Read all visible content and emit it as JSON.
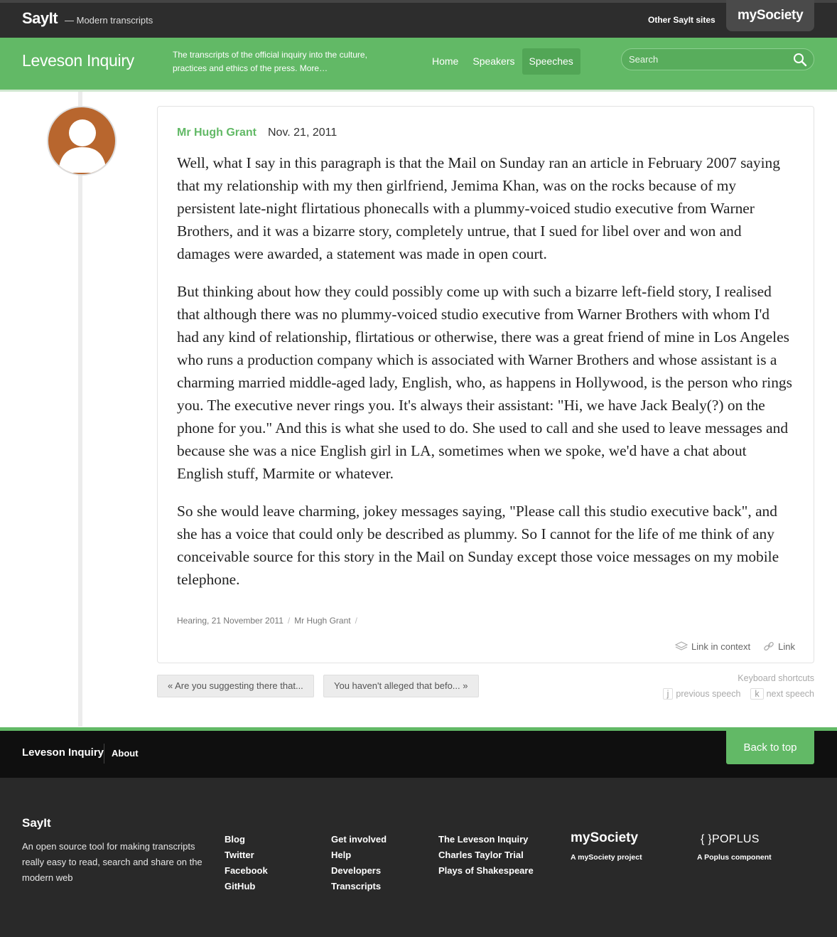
{
  "topbar": {
    "brand": "SayIt",
    "brand_sub": "— Modern transcripts",
    "other_sites": "Other SayIt sites",
    "mysociety": "mySociety"
  },
  "header": {
    "site_title": "Leveson Inquiry",
    "description": "The transcripts of the official inquiry into the culture, practices and ethics of the press. More…",
    "nav": [
      "Home",
      "Speakers",
      "Speeches"
    ],
    "active_nav": "Speeches",
    "search_placeholder": "Search"
  },
  "speech": {
    "speaker": "Mr Hugh Grant",
    "date": "Nov. 21, 2011",
    "paragraphs": [
      "Well, what I say in this paragraph is that the Mail on Sunday ran an article in February 2007 saying that my relationship with my then girlfriend, Jemima Khan, was on the rocks because of my persistent late-night flirtatious phonecalls with a plummy-voiced studio executive from Warner Brothers, and it was a bizarre story, completely untrue, that I sued for libel over and won and damages were awarded, a statement was made in open court.",
      "But thinking about how they could possibly come up with such a bizarre left-field story, I realised that although there was no plummy-voiced studio executive from Warner Brothers with whom I'd had any kind of relationship, flirtatious or otherwise, there was a great friend of mine in Los Angeles who runs a production company which is associated with Warner Brothers and whose assistant is a charming married middle-aged lady, English, who, as happens in Hollywood, is the person who rings you. The executive never rings you. It's always their assistant: \"Hi, we have Jack Bealy(?) on the phone for you.\" And this is what she used to do. She used to call and she used to leave messages and because she was a nice English girl in LA, sometimes when we spoke, we'd have a chat about English stuff, Marmite or whatever.",
      "So she would leave charming, jokey messages saying, \"Please call this studio executive back\", and she has a voice that could only be described as plummy. So I cannot for the life of me think of any conceivable source for this story in the Mail on Sunday except those voice messages on my mobile telephone."
    ],
    "breadcrumbs": [
      "Hearing, 21 November 2011",
      "Mr Hugh Grant"
    ],
    "link_in_context": "Link in context",
    "link": "Link"
  },
  "navigation": {
    "prev": "« Are you suggesting there that...",
    "next": "You haven't alleged that befo... »",
    "shortcuts_title": "Keyboard shortcuts",
    "prev_key": "j",
    "prev_label": "previous speech",
    "next_key": "k",
    "next_label": "next speech"
  },
  "footer": {
    "site_title": "Leveson Inquiry",
    "about": "About",
    "back_to_top": "Back to top",
    "brand": "SayIt",
    "desc": "An open source tool for making transcripts really easy to read, search and share on the modern web",
    "col1": [
      "Blog",
      "Twitter",
      "Facebook",
      "GitHub"
    ],
    "col2": [
      "Get involved",
      "Help",
      "Developers",
      "Transcripts"
    ],
    "col3": [
      "The Leveson Inquiry",
      "Charles Taylor Trial",
      "Plays of Shakespeare"
    ],
    "mysociety_logo": "mySociety",
    "mysociety_caption": "A mySociety project",
    "poplus_logo": "POPLUS",
    "poplus_caption": "A Poplus component"
  },
  "colors": {
    "green": "#62b966",
    "dark": "#2d2d2d",
    "avatar": "#b8662e"
  }
}
